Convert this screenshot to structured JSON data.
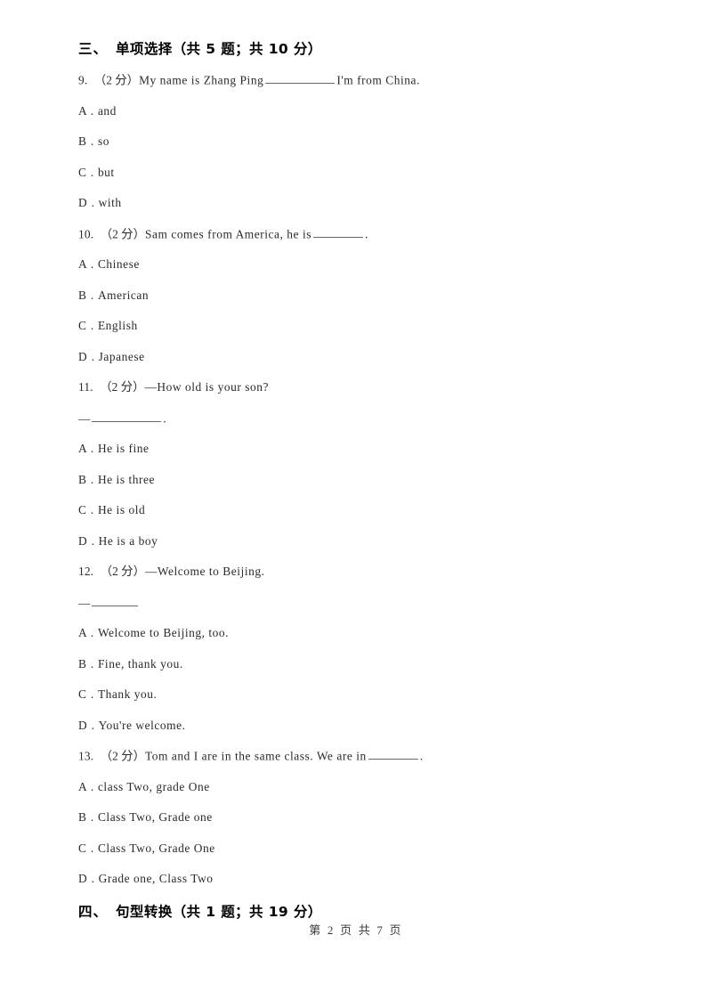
{
  "document": {
    "page_footer": "第 2 页 共 7 页"
  },
  "sections": [
    {
      "number": "三、",
      "title": "单项选择",
      "meta": "（共 5 题；共 10 分）"
    },
    {
      "number": "四、",
      "title": "句型转换",
      "meta": "（共 1 题；共 19 分）"
    }
  ],
  "questions": [
    {
      "number": "9.",
      "marks": "（2 分）",
      "stem": "My name is Zhang Ping",
      "stem_tail": "I'm from China.",
      "blank": "long",
      "second_line": null,
      "options": [
        {
          "letter": "A .",
          "text": "and"
        },
        {
          "letter": "B .",
          "text": "so"
        },
        {
          "letter": "C .",
          "text": "but"
        },
        {
          "letter": "D .",
          "text": "with"
        }
      ]
    },
    {
      "number": "10.",
      "marks": "（2 分）",
      "stem": "Sam comes from America, he is",
      "stem_tail": ".",
      "blank": "med",
      "second_line": null,
      "options": [
        {
          "letter": "A .",
          "text": "Chinese"
        },
        {
          "letter": "B .",
          "text": "American"
        },
        {
          "letter": "C .",
          "text": "English"
        },
        {
          "letter": "D .",
          "text": "Japanese"
        }
      ]
    },
    {
      "number": "11.",
      "marks": "（2 分）",
      "stem": "—How old is your son?",
      "stem_tail": "",
      "blank": "none",
      "second_line": {
        "dash": "—",
        "blank": "long",
        "tail": "."
      },
      "options": [
        {
          "letter": "A .",
          "text": "He is fine"
        },
        {
          "letter": "B .",
          "text": "He is three"
        },
        {
          "letter": "C .",
          "text": "He is old"
        },
        {
          "letter": "D .",
          "text": "He is a boy"
        }
      ]
    },
    {
      "number": "12.",
      "marks": "（2 分）",
      "stem": "—Welcome to Beijing.",
      "stem_tail": "",
      "blank": "none",
      "second_line": {
        "dash": "—",
        "blank": "short",
        "tail": ""
      },
      "options": [
        {
          "letter": "A .",
          "text": "Welcome to Beijing, too."
        },
        {
          "letter": "B .",
          "text": "Fine, thank you."
        },
        {
          "letter": "C .",
          "text": "Thank you."
        },
        {
          "letter": "D .",
          "text": "You're welcome."
        }
      ]
    },
    {
      "number": "13.",
      "marks": "（2 分）",
      "stem": "Tom and I are in the same class. We are in",
      "stem_tail": ".",
      "blank": "med",
      "second_line": null,
      "options": [
        {
          "letter": "A .",
          "text": "class Two, grade One"
        },
        {
          "letter": "B .",
          "text": "Class Two, Grade one"
        },
        {
          "letter": "C .",
          "text": "Class Two, Grade One"
        },
        {
          "letter": "D .",
          "text": "Grade one, Class Two"
        }
      ]
    }
  ]
}
